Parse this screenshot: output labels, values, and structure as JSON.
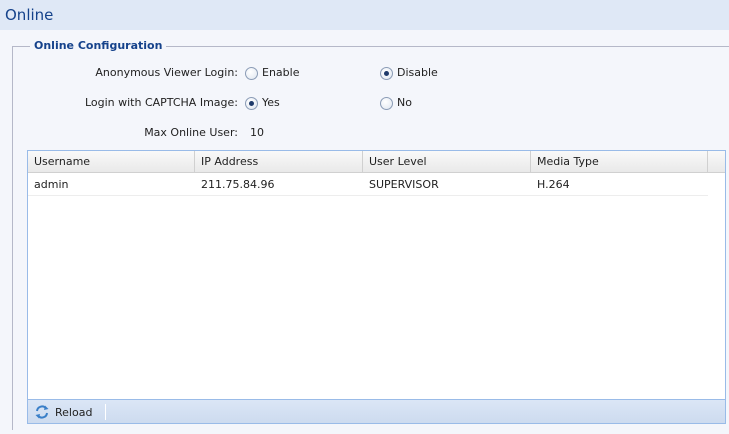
{
  "page": {
    "title": "Online"
  },
  "config": {
    "legend": "Online Configuration",
    "anonymous": {
      "label": "Anonymous Viewer Login:",
      "options": [
        "Enable",
        "Disable"
      ],
      "selected": "Disable"
    },
    "captcha": {
      "label": "Login with CAPTCHA Image:",
      "options": [
        "Yes",
        "No"
      ],
      "selected": "Yes"
    },
    "max_online": {
      "label": "Max Online User:",
      "value": "10"
    }
  },
  "grid": {
    "columns": [
      "Username",
      "IP Address",
      "User Level",
      "Media Type"
    ],
    "rows": [
      [
        "admin",
        "211.75.84.96",
        "SUPERVISOR",
        "H.264"
      ]
    ]
  },
  "toolbar": {
    "reload_label": "Reload",
    "reload_icon": "refresh-icon"
  },
  "colors": {
    "title": "#15428b",
    "header_band": "#dfe8f6",
    "grid_border": "#99bbe8"
  }
}
